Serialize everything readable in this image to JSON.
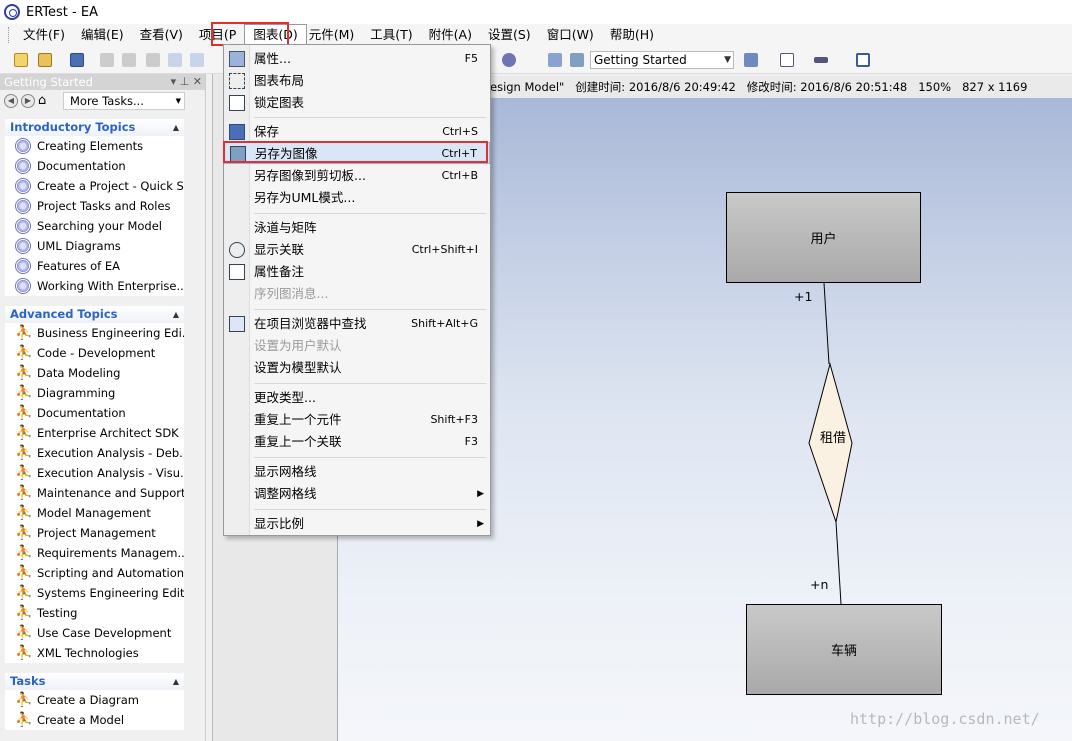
{
  "window": {
    "title": "ERTest - EA"
  },
  "menubar": {
    "items": [
      {
        "label": "文件(F)"
      },
      {
        "label": "编辑(E)"
      },
      {
        "label": "查看(V)"
      },
      {
        "label": "项目(P"
      },
      {
        "label": "图表(D)"
      },
      {
        "label": "元件(M)"
      },
      {
        "label": "工具(T)"
      },
      {
        "label": "附件(A)"
      },
      {
        "label": "设置(S)"
      },
      {
        "label": "窗口(W)"
      },
      {
        "label": "帮助(H)"
      }
    ]
  },
  "toolbar": {
    "workspace_combo": "Getting Started"
  },
  "left_panel": {
    "title": "Getting Started",
    "more_tasks": "More Tasks...",
    "sections": [
      {
        "title": "Introductory Topics",
        "items": [
          "Creating Elements",
          "Documentation",
          "Create a Project - Quick S...",
          "Project Tasks and Roles",
          "Searching your Model",
          "UML Diagrams",
          "Features of EA",
          "Working With Enterprise..."
        ]
      },
      {
        "title": "Advanced Topics",
        "items": [
          "Business Engineering Edi...",
          "Code - Development",
          "Data Modeling",
          "Diagramming",
          "Documentation",
          "Enterprise Architect SDK",
          "Execution Analysis - Deb...",
          "Execution Analysis - Visu...",
          "Maintenance and Support",
          "Model Management",
          "Project Management",
          "Requirements Managem...",
          "Scripting and Automation",
          "Systems Engineering Edit...",
          "Testing",
          "Use Case Development",
          "XML Technologies"
        ]
      },
      {
        "title": "Tasks",
        "items": [
          "Create a Diagram",
          "Create a Model"
        ]
      }
    ]
  },
  "diagram_header": {
    "name": "esign Model\"",
    "created_label": "创建时间:",
    "created": "2016/8/6 20:49:42",
    "modified_label": "修改时间:",
    "modified": "2016/8/6 20:51:48",
    "zoom": "150%",
    "size": "827 x 1169"
  },
  "diagram": {
    "entity_top": "用户",
    "entity_bottom": "车辆",
    "relationship": "租借",
    "mult_top": "+1",
    "mult_bottom": "+n"
  },
  "dropdown": {
    "items": [
      {
        "label": "属性...",
        "shortcut": "F5",
        "disabled": false
      },
      {
        "label": "图表布局",
        "shortcut": "",
        "disabled": false
      },
      {
        "label": "锁定图表",
        "shortcut": "",
        "disabled": false
      },
      {
        "label": "保存",
        "shortcut": "Ctrl+S",
        "disabled": false
      },
      {
        "label": "另存为图像",
        "shortcut": "Ctrl+T",
        "disabled": false
      },
      {
        "label": "另存图像到剪切板...",
        "shortcut": "Ctrl+B",
        "disabled": false
      },
      {
        "label": "另存为UML模式...",
        "shortcut": "",
        "disabled": false
      },
      {
        "label": "泳道与矩阵",
        "shortcut": "",
        "disabled": false
      },
      {
        "label": "显示关联",
        "shortcut": "Ctrl+Shift+I",
        "disabled": false
      },
      {
        "label": "属性备注",
        "shortcut": "",
        "disabled": false
      },
      {
        "label": "序列图消息...",
        "shortcut": "",
        "disabled": true
      },
      {
        "label": "在项目浏览器中查找",
        "shortcut": "Shift+Alt+G",
        "disabled": false
      },
      {
        "label": "设置为用户默认",
        "shortcut": "",
        "disabled": true
      },
      {
        "label": "设置为模型默认",
        "shortcut": "",
        "disabled": false
      },
      {
        "label": "更改类型...",
        "shortcut": "",
        "disabled": false
      },
      {
        "label": "重复上一个元件",
        "shortcut": "Shift+F3",
        "disabled": false
      },
      {
        "label": "重复上一个关联",
        "shortcut": "F3",
        "disabled": false
      },
      {
        "label": "显示网格线",
        "shortcut": "",
        "disabled": false
      },
      {
        "label": "调整网格线",
        "shortcut": "",
        "disabled": false
      },
      {
        "label": "显示比例",
        "shortcut": "",
        "disabled": false
      }
    ]
  },
  "watermark": "http://blog.csdn.net/",
  "colors": {
    "highlight_border": "#e03030",
    "menu_highlight": "#d9e6f7",
    "section_title": "#2b63c8"
  }
}
